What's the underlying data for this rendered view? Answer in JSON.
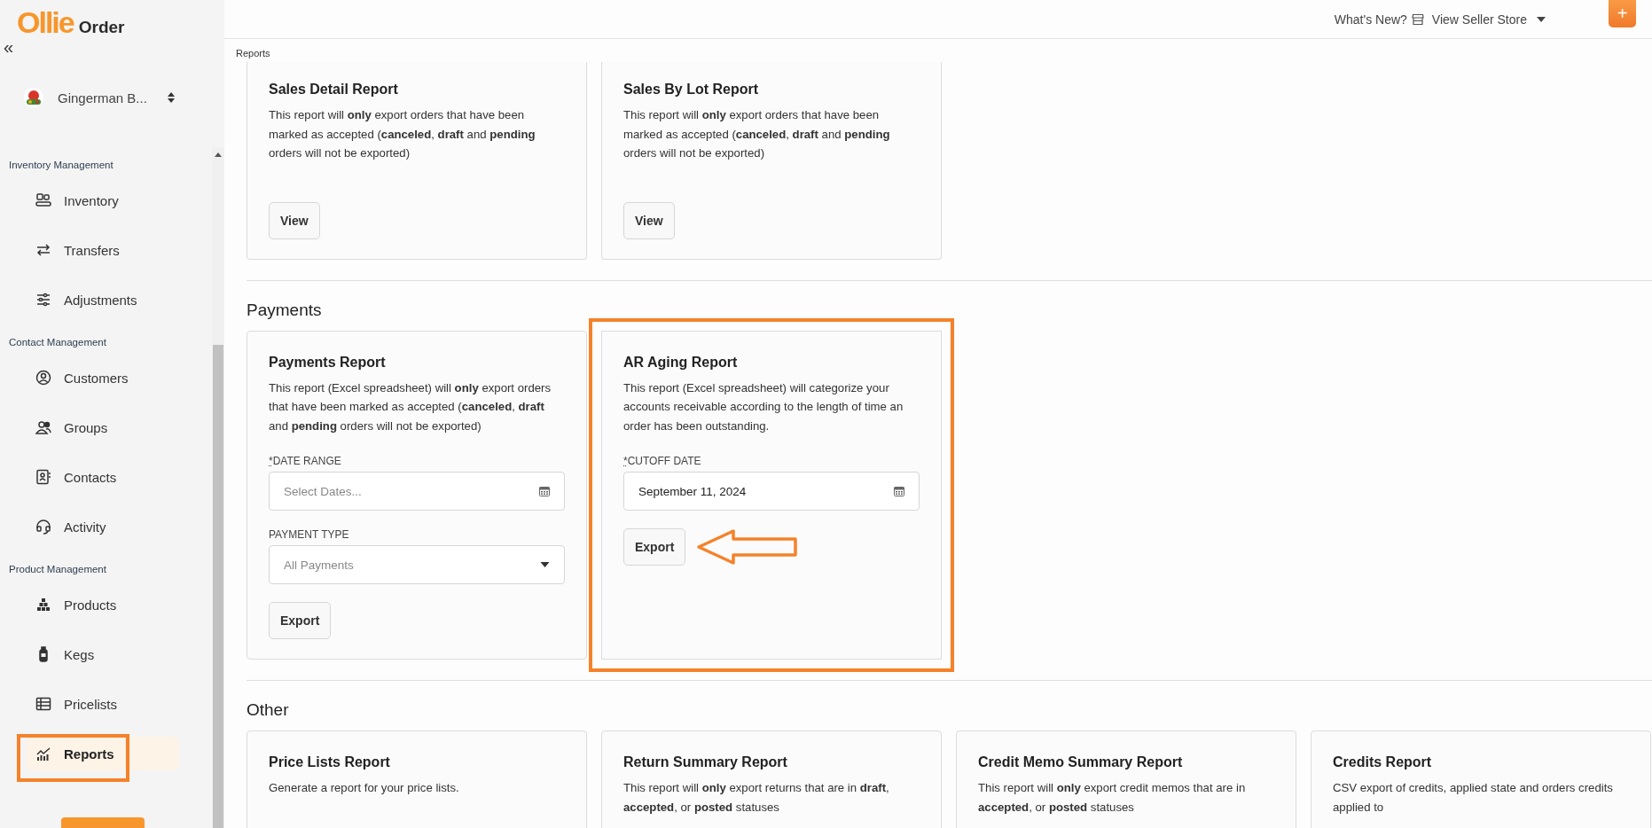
{
  "sidebar": {
    "logo_brand": "Ollie",
    "logo_product": "Order",
    "collapse": "«",
    "account": "Gingerman B...",
    "groups": [
      {
        "heading": "Inventory Management",
        "items": [
          {
            "label": "Inventory",
            "selected": false,
            "annotated": false
          },
          {
            "label": "Transfers",
            "selected": false,
            "annotated": false
          },
          {
            "label": "Adjustments",
            "selected": false,
            "annotated": false
          }
        ]
      },
      {
        "heading": "Contact Management",
        "items": [
          {
            "label": "Customers",
            "selected": false,
            "annotated": false
          },
          {
            "label": "Groups",
            "selected": false,
            "annotated": false
          },
          {
            "label": "Contacts",
            "selected": false,
            "annotated": false
          },
          {
            "label": "Activity",
            "selected": false,
            "annotated": false
          }
        ]
      },
      {
        "heading": "Product Management",
        "items": [
          {
            "label": "Products",
            "selected": false,
            "annotated": false
          },
          {
            "label": "Kegs",
            "selected": false,
            "annotated": false
          },
          {
            "label": "Pricelists",
            "selected": false,
            "annotated": false
          },
          {
            "label": "Reports",
            "selected": true,
            "annotated": true
          }
        ]
      }
    ]
  },
  "topbar": {
    "whats_new": "What's New?",
    "store_link": "View Seller Store",
    "add_button": "+"
  },
  "breadcrumb": "Reports",
  "sections": [
    {
      "cards": [
        {
          "title": "Sales Detail Report",
          "description": "This report will **only** export orders that have been marked as accepted (**canceled**, **draft** and **pending** orders will not be exported)",
          "button": "View",
          "annotated": false
        },
        {
          "title": "Sales By Lot Report",
          "description": "This report will **only** export orders that have been marked as accepted (**canceled**, **draft** and **pending** orders will not be exported)",
          "button": "View",
          "annotated": false
        }
      ]
    },
    {
      "title": "Payments",
      "cards": [
        {
          "title": "Payments Report",
          "description": "This report (Excel spreadsheet) will **only** export orders that have been marked as accepted (**canceled**, **draft** and **pending** orders will not be exported)",
          "fields": [
            {
              "kind": "date",
              "required_mark": "*",
              "label": "DATE RANGE",
              "placeholder": "Select Dates..."
            },
            {
              "kind": "select",
              "label": "PAYMENT TYPE",
              "placeholder": "All Payments"
            }
          ],
          "button": "Export",
          "annotated": false
        },
        {
          "title": "AR Aging Report",
          "description": "This report (Excel spreadsheet) will categorize your accounts receivable according to the length of time an order has been outstanding.",
          "fields": [
            {
              "kind": "date",
              "required_mark": "*",
              "label": "CUTOFF DATE",
              "value": "September 11, 2024"
            }
          ],
          "button": "Export",
          "annotated": true
        }
      ]
    },
    {
      "title": "Other",
      "cards": [
        {
          "title": "Price Lists Report",
          "description": "Generate a report for your price lists."
        },
        {
          "title": "Return Summary Report",
          "description": "This report will **only** export returns that are in **draft**, **accepted**, or **posted** statuses"
        },
        {
          "title": "Credit Memo Summary Report",
          "description": "This report will **only** export credit memos that are in **accepted**, or **posted** statuses"
        },
        {
          "title": "Credits Report",
          "description": "CSV export of credits, applied state and orders credits applied to"
        }
      ]
    }
  ]
}
